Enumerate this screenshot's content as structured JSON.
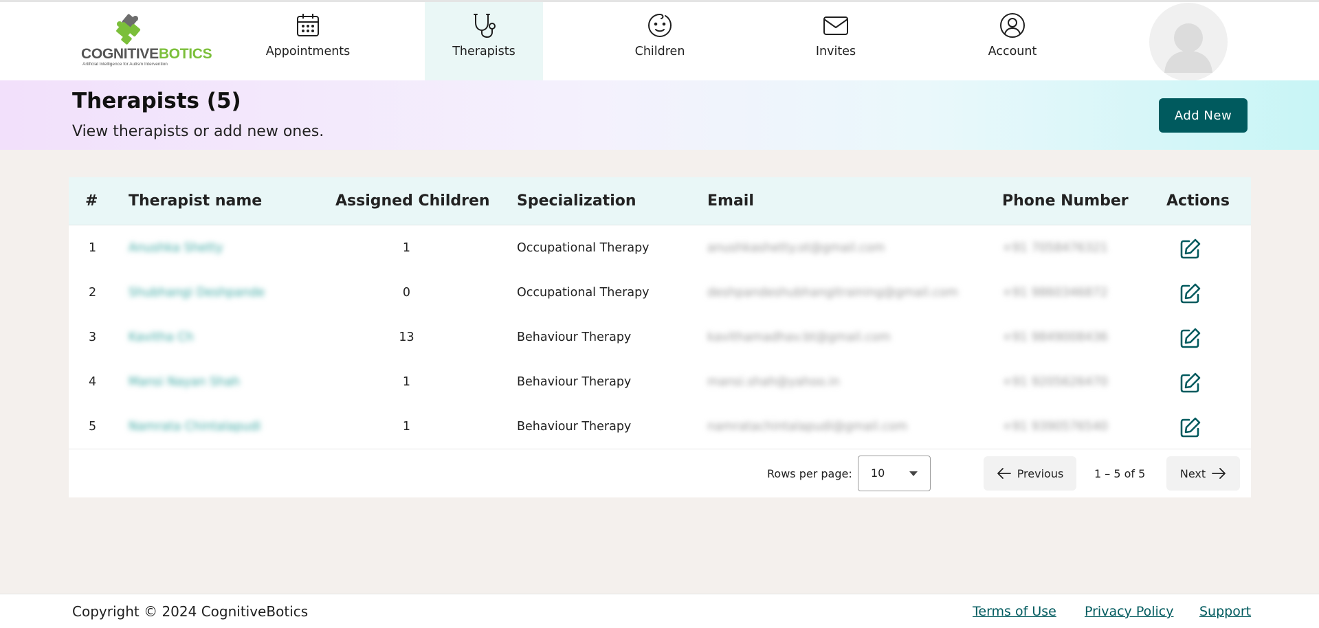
{
  "brand": {
    "logo_main": "COGNITIVE",
    "logo_accent": "BOTICS",
    "tagline": "Artificial Intelligence for Autism Intervention",
    "accent_color": "#7bbf3a",
    "primary_color": "#005a5e"
  },
  "nav": {
    "appointments": {
      "label": "Appointments",
      "icon": "calendar-icon"
    },
    "therapists": {
      "label": "Therapists",
      "icon": "stethoscope-icon",
      "active": true
    },
    "children": {
      "label": "Children",
      "icon": "baby-face-icon"
    },
    "invites": {
      "label": "Invites",
      "icon": "envelope-icon"
    },
    "account": {
      "label": "Account",
      "icon": "user-circle-icon"
    }
  },
  "banner": {
    "title": "Therapists (5)",
    "subtitle": "View therapists or add new ones.",
    "add_button": "Add New"
  },
  "table": {
    "headers": {
      "index": "#",
      "name": "Therapist name",
      "assigned": "Assigned Children",
      "specialization": "Specialization",
      "email": "Email",
      "phone": "Phone Number",
      "actions": "Actions"
    },
    "rows": [
      {
        "index": "1",
        "name": "Anushka Shetty",
        "assigned": "1",
        "specialization": "Occupational Therapy",
        "email": "anushkashetty.ot@gmail.com",
        "phone": "+91 7058476321"
      },
      {
        "index": "2",
        "name": "Shubhangi Deshpande",
        "assigned": "0",
        "specialization": "Occupational Therapy",
        "email": "deshpandeshubhangitraining@gmail.com",
        "phone": "+91 9860346872"
      },
      {
        "index": "3",
        "name": "Kavitha Ch",
        "assigned": "13",
        "specialization": "Behaviour Therapy",
        "email": "kavithamadhav.bt@gmail.com",
        "phone": "+91 9849008436"
      },
      {
        "index": "4",
        "name": "Mansi Nayan Shah",
        "assigned": "1",
        "specialization": "Behaviour Therapy",
        "email": "mansi.shah@yahoo.in",
        "phone": "+91 9205626470"
      },
      {
        "index": "5",
        "name": "Namrata Chintalapudi",
        "assigned": "1",
        "specialization": "Behaviour Therapy",
        "email": "namratachintalapudi@gmail.com",
        "phone": "+91 9390576540"
      }
    ]
  },
  "pagination": {
    "rows_per_page_label": "Rows per page:",
    "rows_per_page_value": "10",
    "previous": "Previous",
    "next": "Next",
    "range": "1 – 5 of 5"
  },
  "footer": {
    "copyright": "Copyright © 2024 CognitiveBotics",
    "terms": "Terms of Use",
    "privacy": "Privacy Policy",
    "support": "Support"
  }
}
